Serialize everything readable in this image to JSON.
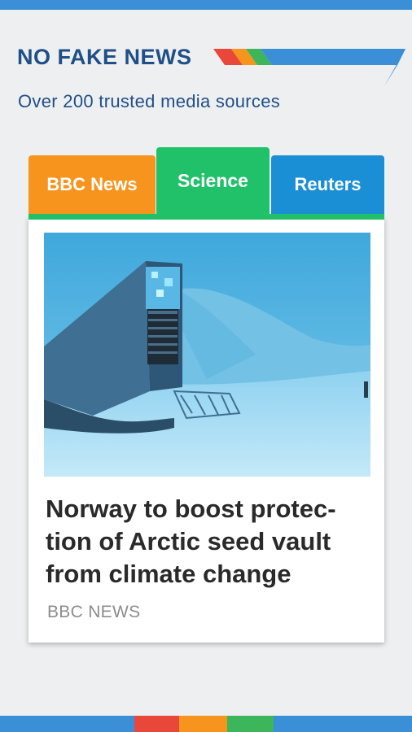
{
  "header": {
    "title": "NO FAKE NEWS",
    "subtitle": "Over 200 trusted media sources"
  },
  "tabs": [
    {
      "label": "BBC News",
      "color": "#f7941d",
      "selected": false
    },
    {
      "label": "Science",
      "color": "#21c16a",
      "selected": true
    },
    {
      "label": "Reuters",
      "color": "#1a8fd6",
      "selected": false
    }
  ],
  "article": {
    "image_description_icon": "seed-vault-photo",
    "title": "Norway to boost protec-tion of Arctic seed vault from climate change",
    "title_lines": [
      "Norway to boost protec-",
      "tion of Arctic seed vault",
      "from climate change"
    ],
    "source": "BBC NEWS"
  },
  "colors": {
    "brand_blue": "#1f4f86",
    "accent_red": "#e8473a",
    "accent_orange": "#f7941d",
    "accent_green": "#3db55b",
    "accent_blue": "#3a8fd6"
  }
}
